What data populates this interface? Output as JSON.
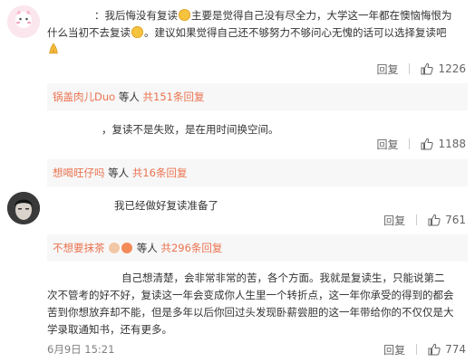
{
  "comments": [
    {
      "line1_a": "：我后悔没有复读",
      "line1_b": "主要是觉得自己没有尽全力，大学这一年都在懊恼悔恨为",
      "line2_a": "什么当初不去复读",
      "line2_b": "。建议如果觉得自己还不够努力不够问心无愧的话可以选择复读吧",
      "reply_label": "回复",
      "like_count": "1226"
    },
    {
      "line1": "，复读不是失败，是在用时间换空间。",
      "reply_label": "回复",
      "like_count": "1188"
    },
    {
      "line1": "我已经做好复读准备了",
      "reply_label": "回复",
      "like_count": "761"
    },
    {
      "line1": "自己想清楚，会非常非常的苦，各个方面。我就是复读生，只能说第二",
      "line2": "次不管考的好不好，复读这一年会变成你人生里一个转折点，这一年你承受的得到的都会",
      "line3": "苦到你想放弃却不能，但是多年以后你回过头发现卧薪尝胆的这一年带给你的不仅仅是大",
      "line4": "学录取通知书，还有更多。",
      "timestamp": "6月9日 15:21",
      "reply_label": "回复",
      "like_count": "774"
    }
  ],
  "reply_bars": [
    {
      "name": "锅盖肉儿Duo",
      "middle": " 等人 ",
      "more": "共151条回复"
    },
    {
      "name": "想喝旺仔吗",
      "middle": " 等人 ",
      "more": "共16条回复"
    },
    {
      "name": "不想要抹茶",
      "middle": " 等人 ",
      "more": "共296条回复"
    }
  ],
  "colors": {
    "accent": "#eb7350",
    "text": "#333333",
    "muted": "#808080",
    "reply_bg": "#f7f7f7"
  }
}
